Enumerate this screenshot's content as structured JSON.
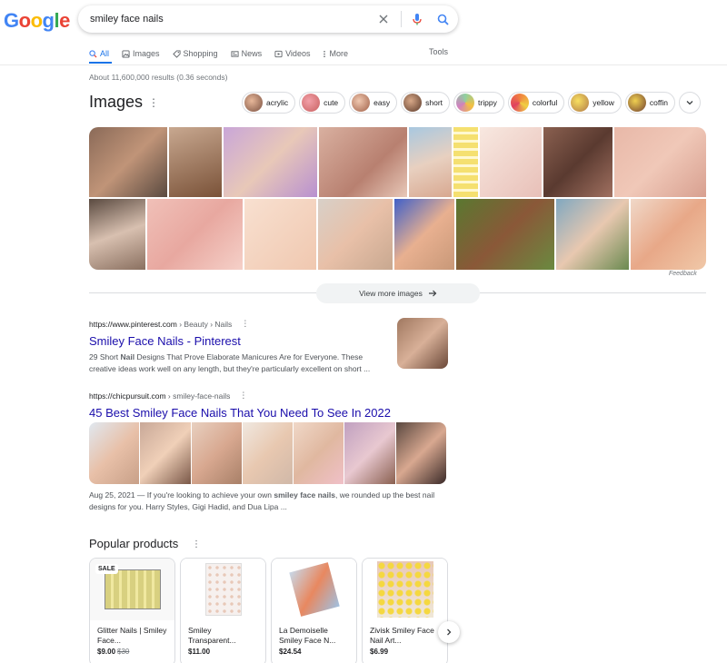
{
  "search": {
    "query": "smiley face nails"
  },
  "tabs": [
    {
      "label": "All",
      "icon": "search-icon",
      "active": true
    },
    {
      "label": "Images",
      "icon": "image-icon"
    },
    {
      "label": "Shopping",
      "icon": "tag-icon"
    },
    {
      "label": "News",
      "icon": "news-icon"
    },
    {
      "label": "Videos",
      "icon": "video-icon"
    },
    {
      "label": "More",
      "icon": "more-vert-icon"
    }
  ],
  "tools_label": "Tools",
  "result_stats": "About 11,600,000 results (0.36 seconds)",
  "images": {
    "title": "Images",
    "chips": [
      "acrylic",
      "cute",
      "easy",
      "short",
      "trippy",
      "colorful",
      "yellow",
      "coffin"
    ],
    "feedback": "Feedback",
    "view_more": "View more images"
  },
  "results": [
    {
      "url": "https://www.pinterest.com",
      "crumbs": " › Beauty › Nails",
      "title": "Smiley Face Nails - Pinterest",
      "snippet_pre": "29 Short ",
      "snippet_bold": "Nail",
      "snippet_post": " Designs That Prove Elaborate Manicures Are for Everyone. These creative ideas work well on any length, but they're particularly excellent on short ..."
    },
    {
      "url": "https://chicpursuit.com",
      "crumbs": " › smiley-face-nails",
      "title": "45 Best Smiley Face Nails That You Need To See In 2022",
      "snippet_pre": "Aug 25, 2021 — If you're looking to achieve your own ",
      "snippet_bold": "smiley face nails",
      "snippet_post": ", we rounded up the best nail designs for you. Harry Styles, Gigi Hadid, and Dua Lipa ..."
    }
  ],
  "products": {
    "title": "Popular products",
    "items": [
      {
        "name": "Glitter Nails | Smiley Face...",
        "price": "$9.00",
        "old_price": "$30",
        "badge": "SALE"
      },
      {
        "name": "Smiley Transparent...",
        "price": "$11.00"
      },
      {
        "name": "La Demoiselle Smiley Face N...",
        "price": "$24.54"
      },
      {
        "name": "Zivisk Smiley Face Nail Art...",
        "price": "$6.99"
      }
    ]
  },
  "colors": {
    "link": "#1a0dab",
    "accent": "#1a73e8",
    "logo_blue": "#4285f4",
    "logo_red": "#ea4335",
    "logo_yellow": "#fbbc05",
    "logo_green": "#34a853"
  }
}
